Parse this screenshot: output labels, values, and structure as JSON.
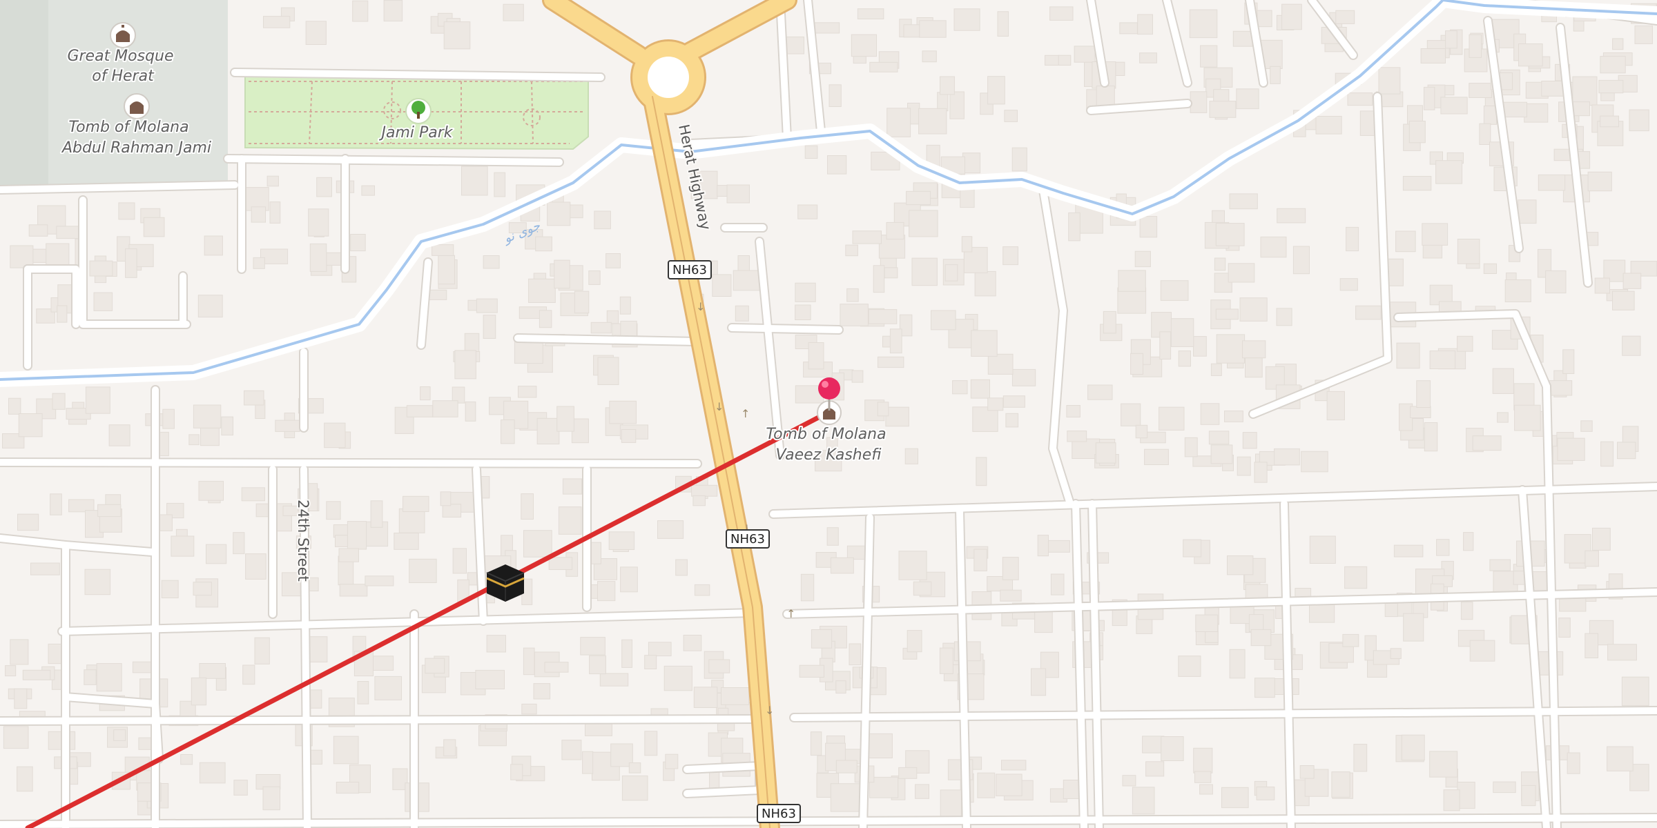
{
  "map": {
    "places": {
      "great_mosque": "Great Mosque of Herat",
      "great_mosque_line1": "Great Mosque",
      "great_mosque_line2": "of Herat",
      "tomb_jami_line1": "Tomb of Molana",
      "tomb_jami_line2": "Abdul Rahman Jami",
      "park": "Jami Park",
      "tomb_kashefi_line1": "Tomb of Molana",
      "tomb_kashefi_line2": "Vaeez Kashefi"
    },
    "streets": {
      "highway": "Herat Highway",
      "street_24": "24th Street",
      "canal": "جوی نو"
    },
    "shields": [
      "NH63",
      "NH63",
      "NH63"
    ],
    "colors": {
      "background": "#f6f3f0",
      "building": "#ede8e3",
      "road": "#ffffff",
      "road_casing": "#d9d4ce",
      "highway": "#fad98d",
      "highway_casing": "#e2b36f",
      "water": "#a6c8ef",
      "park": "#d9efc5",
      "qibla_line": "#dc2e2e",
      "pin": "#e8285f"
    },
    "icons": [
      "mosque-icon",
      "tomb-icon",
      "tree-icon",
      "kaaba-icon",
      "map-pin-icon"
    ]
  }
}
